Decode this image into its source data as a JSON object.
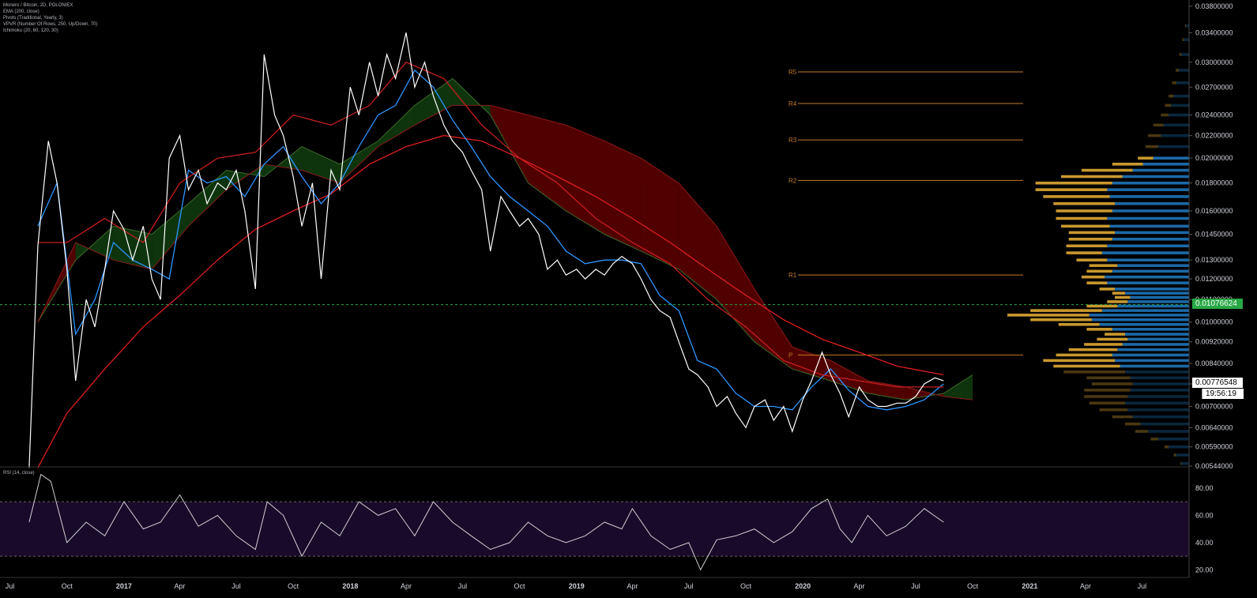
{
  "legend": [
    "Monero / Bitcoin, 2D, POLONIEX",
    "EMA (200, close)",
    "Pivots (Traditional, Yearly, 3)",
    "VPVR (Number Of Rows, 250, Up/Down, 70)",
    "Ichimoku (20, 60, 120, 30)"
  ],
  "rsi_label": "RSI (14, close)",
  "tags": {
    "last_price": "0.00776548",
    "countdown": "19:56:19",
    "horizontal_line_price": "0.01076624"
  },
  "colors": {
    "background": "#000000",
    "price_line": "#ffffff",
    "ema": "#e01e1e",
    "kijun": "#2e95ff",
    "tenkan": "#c81e1e",
    "cloud_bear": "#5a0000",
    "cloud_bull": "#0f3a0f",
    "pivots": "#c47a2a",
    "vp_up": "#1e6fb0",
    "vp_down": "#d4a030",
    "rsi_line": "#cfcfcf",
    "rsi_band": "#1a0a2a",
    "hline": "#27a844"
  },
  "chart_data": [
    {
      "type": "line",
      "log_scale": true,
      "y_ticks": [
        "0.03800000",
        "0.03400000",
        "0.03000000",
        "0.02700000",
        "0.02400000",
        "0.02200000",
        "0.02000000",
        "0.01800000",
        "0.01600000",
        "0.01450000",
        "0.01300000",
        "0.01200000",
        "0.01100000",
        "0.01000000",
        "0.00920000",
        "0.00840000",
        "0.00770000",
        "0.00700000",
        "0.00640000",
        "0.00590000",
        "0.00544000"
      ],
      "x_ticks": [
        "Jul",
        "Oct",
        "2017",
        "Apr",
        "Jul",
        "Oct",
        "2018",
        "Apr",
        "Jul",
        "Oct",
        "2019",
        "Apr",
        "Jul",
        "Oct",
        "2020",
        "Apr",
        "Jul",
        "Oct",
        "2021",
        "Apr",
        "Jul"
      ],
      "x_range": [
        "2016-06-15",
        "2021-09-15"
      ],
      "y_range": [
        0.00544,
        0.038
      ],
      "price": {
        "x": [
          "2016-08-01",
          "2016-08-15",
          "2016-09-01",
          "2016-09-15",
          "2016-10-01",
          "2016-10-15",
          "2016-11-01",
          "2016-11-15",
          "2016-12-01",
          "2016-12-15",
          "2017-01-01",
          "2017-01-15",
          "2017-02-01",
          "2017-02-15",
          "2017-03-01",
          "2017-03-15",
          "2017-04-01",
          "2017-04-15",
          "2017-05-01",
          "2017-05-15",
          "2017-06-01",
          "2017-06-15",
          "2017-07-01",
          "2017-07-15",
          "2017-08-01",
          "2017-08-15",
          "2017-09-01",
          "2017-09-15",
          "2017-10-01",
          "2017-10-15",
          "2017-11-01",
          "2017-11-15",
          "2017-12-01",
          "2017-12-15",
          "2018-01-01",
          "2018-01-15",
          "2018-02-01",
          "2018-02-15",
          "2018-03-01",
          "2018-03-15",
          "2018-04-01",
          "2018-04-15",
          "2018-05-01",
          "2018-05-15",
          "2018-06-01",
          "2018-06-15",
          "2018-07-01",
          "2018-07-15",
          "2018-08-01",
          "2018-08-15",
          "2018-09-01",
          "2018-09-15",
          "2018-10-01",
          "2018-10-15",
          "2018-11-01",
          "2018-11-15",
          "2018-12-01",
          "2018-12-15",
          "2019-01-01",
          "2019-01-15",
          "2019-02-01",
          "2019-02-15",
          "2019-03-01",
          "2019-03-15",
          "2019-04-01",
          "2019-04-15",
          "2019-05-01",
          "2019-05-15",
          "2019-06-01",
          "2019-06-15",
          "2019-07-01",
          "2019-07-15",
          "2019-08-01",
          "2019-08-15",
          "2019-09-01",
          "2019-09-15",
          "2019-10-01",
          "2019-10-15",
          "2019-11-01",
          "2019-11-15",
          "2019-12-01",
          "2019-12-15",
          "2020-01-01",
          "2020-01-15",
          "2020-02-01",
          "2020-02-15",
          "2020-03-01",
          "2020-03-15",
          "2020-04-01",
          "2020-04-15",
          "2020-05-01",
          "2020-05-15",
          "2020-06-01",
          "2020-06-15",
          "2020-07-01",
          "2020-07-15",
          "2020-08-01",
          "2020-08-15"
        ],
        "y": [
          0.0054,
          0.0138,
          0.0215,
          0.018,
          0.0125,
          0.0078,
          0.011,
          0.0098,
          0.0125,
          0.016,
          0.0148,
          0.013,
          0.015,
          0.012,
          0.011,
          0.02,
          0.022,
          0.0175,
          0.019,
          0.0165,
          0.018,
          0.0175,
          0.019,
          0.016,
          0.0115,
          0.031,
          0.024,
          0.022,
          0.0185,
          0.015,
          0.018,
          0.012,
          0.019,
          0.0175,
          0.027,
          0.024,
          0.03,
          0.026,
          0.031,
          0.028,
          0.034,
          0.027,
          0.03,
          0.026,
          0.023,
          0.0215,
          0.0205,
          0.019,
          0.0175,
          0.0135,
          0.017,
          0.016,
          0.015,
          0.0155,
          0.0145,
          0.0125,
          0.013,
          0.0122,
          0.0125,
          0.012,
          0.0125,
          0.0122,
          0.0128,
          0.0132,
          0.0128,
          0.012,
          0.011,
          0.0105,
          0.0102,
          0.0092,
          0.0082,
          0.008,
          0.0076,
          0.007,
          0.0073,
          0.0068,
          0.0064,
          0.007,
          0.0072,
          0.0066,
          0.007,
          0.0063,
          0.0072,
          0.0078,
          0.0088,
          0.008,
          0.0074,
          0.0067,
          0.0076,
          0.0072,
          0.007,
          0.007,
          0.0071,
          0.0071,
          0.0073,
          0.0077,
          0.0079,
          0.0078
        ]
      },
      "series": [
        {
          "indicator": "EMA",
          "x": [
            "2016-08-15",
            "2016-10-01",
            "2016-12-01",
            "2017-02-01",
            "2017-04-01",
            "2017-06-01",
            "2017-08-01",
            "2017-10-01",
            "2017-12-01",
            "2018-02-01",
            "2018-04-01",
            "2018-06-01",
            "2018-08-01",
            "2018-10-01",
            "2018-12-01",
            "2019-02-01",
            "2019-04-01",
            "2019-06-01",
            "2019-08-01",
            "2019-10-01",
            "2019-12-01",
            "2020-02-01",
            "2020-04-01",
            "2020-06-01",
            "2020-08-15"
          ],
          "y": [
            0.0054,
            0.0068,
            0.0082,
            0.0098,
            0.0112,
            0.013,
            0.0148,
            0.016,
            0.0172,
            0.0195,
            0.021,
            0.022,
            0.0215,
            0.02,
            0.0185,
            0.017,
            0.0155,
            0.014,
            0.0125,
            0.0112,
            0.0101,
            0.0093,
            0.0088,
            0.0083,
            0.008
          ]
        },
        {
          "indicator": "Kijun",
          "x": [
            "2016-08-15",
            "2016-09-15",
            "2016-10-15",
            "2016-11-15",
            "2016-12-15",
            "2017-01-15",
            "2017-02-15",
            "2017-03-15",
            "2017-04-15",
            "2017-05-15",
            "2017-06-15",
            "2017-07-15",
            "2017-08-15",
            "2017-09-15",
            "2017-10-15",
            "2017-11-15",
            "2017-12-15",
            "2018-01-15",
            "2018-02-15",
            "2018-03-15",
            "2018-04-15",
            "2018-05-15",
            "2018-06-15",
            "2018-07-15",
            "2018-08-15",
            "2018-09-15",
            "2018-10-15",
            "2018-11-15",
            "2018-12-15",
            "2019-01-15",
            "2019-02-15",
            "2019-03-15",
            "2019-04-15",
            "2019-05-15",
            "2019-06-15",
            "2019-07-15",
            "2019-08-15",
            "2019-09-15",
            "2019-10-15",
            "2019-11-15",
            "2019-12-15",
            "2020-01-15",
            "2020-02-15",
            "2020-03-15",
            "2020-04-15",
            "2020-05-15",
            "2020-06-15",
            "2020-07-15",
            "2020-08-15"
          ],
          "y": [
            0.015,
            0.018,
            0.0095,
            0.011,
            0.014,
            0.013,
            0.0125,
            0.012,
            0.019,
            0.018,
            0.0185,
            0.017,
            0.0195,
            0.021,
            0.0185,
            0.0165,
            0.018,
            0.021,
            0.024,
            0.025,
            0.029,
            0.027,
            0.0235,
            0.021,
            0.0185,
            0.017,
            0.016,
            0.015,
            0.0135,
            0.0128,
            0.013,
            0.013,
            0.0128,
            0.0112,
            0.0105,
            0.0085,
            0.0082,
            0.0074,
            0.007,
            0.007,
            0.0069,
            0.0076,
            0.0082,
            0.0075,
            0.007,
            0.0069,
            0.007,
            0.0072,
            0.0077
          ]
        },
        {
          "indicator": "Tenkan",
          "x": [
            "2016-08-15",
            "2016-10-01",
            "2016-12-01",
            "2017-02-01",
            "2017-04-01",
            "2017-06-01",
            "2017-08-01",
            "2017-10-01",
            "2017-12-01",
            "2018-02-01",
            "2018-04-01",
            "2018-06-01",
            "2018-08-01",
            "2018-10-01",
            "2018-12-01",
            "2019-02-01",
            "2019-04-01",
            "2019-06-01",
            "2019-08-01",
            "2019-10-01",
            "2019-12-01",
            "2020-02-01",
            "2020-04-01",
            "2020-06-01",
            "2020-08-15"
          ],
          "y": [
            0.014,
            0.014,
            0.0155,
            0.014,
            0.018,
            0.02,
            0.0205,
            0.024,
            0.023,
            0.025,
            0.03,
            0.028,
            0.023,
            0.02,
            0.018,
            0.0155,
            0.014,
            0.0128,
            0.011,
            0.0098,
            0.0085,
            0.008,
            0.0078,
            0.0076,
            0.0076
          ]
        },
        {
          "indicator": "RSI",
          "x": [
            "2016-08-01",
            "2016-08-20",
            "2016-09-05",
            "2016-10-01",
            "2016-11-01",
            "2016-12-01",
            "2017-01-01",
            "2017-02-01",
            "2017-03-01",
            "2017-04-01",
            "2017-05-01",
            "2017-06-01",
            "2017-07-01",
            "2017-08-01",
            "2017-08-20",
            "2017-09-15",
            "2017-10-15",
            "2017-11-15",
            "2017-12-15",
            "2018-01-15",
            "2018-02-15",
            "2018-03-15",
            "2018-04-15",
            "2018-05-15",
            "2018-06-15",
            "2018-07-15",
            "2018-08-15",
            "2018-09-15",
            "2018-10-15",
            "2018-11-15",
            "2018-12-15",
            "2019-01-15",
            "2019-02-15",
            "2019-03-15",
            "2019-04-01",
            "2019-05-01",
            "2019-06-01",
            "2019-07-01",
            "2019-07-20",
            "2019-08-15",
            "2019-09-15",
            "2019-10-15",
            "2019-11-15",
            "2019-12-15",
            "2020-01-15",
            "2020-02-10",
            "2020-03-01",
            "2020-03-20",
            "2020-04-15",
            "2020-05-15",
            "2020-06-15",
            "2020-07-15",
            "2020-08-15"
          ],
          "y": [
            55,
            90,
            85,
            40,
            55,
            45,
            70,
            50,
            55,
            75,
            52,
            60,
            45,
            35,
            70,
            60,
            30,
            55,
            45,
            70,
            60,
            65,
            45,
            70,
            55,
            45,
            35,
            40,
            55,
            45,
            40,
            45,
            55,
            50,
            65,
            45,
            35,
            40,
            20,
            42,
            45,
            50,
            40,
            48,
            65,
            72,
            50,
            40,
            60,
            45,
            52,
            65,
            55
          ],
          "ylim": [
            15,
            95
          ],
          "y_ticks": [
            "80.00",
            "60.00",
            "40.00",
            "20.00"
          ],
          "bands": [
            70,
            30
          ]
        }
      ],
      "ichimoku_cloud": {
        "x": [
          "2016-08-15",
          "2016-10-15",
          "2016-12-15",
          "2017-02-15",
          "2017-04-15",
          "2017-06-15",
          "2017-08-15",
          "2017-10-15",
          "2017-12-15",
          "2018-02-15",
          "2018-04-15",
          "2018-06-15",
          "2018-08-15",
          "2018-10-15",
          "2018-12-15",
          "2019-02-15",
          "2019-04-15",
          "2019-06-15",
          "2019-08-15",
          "2019-10-15",
          "2019-12-15",
          "2020-02-15",
          "2020-04-15",
          "2020-06-15",
          "2020-08-15",
          "2020-10-01"
        ],
        "span_a": [
          0.01,
          0.013,
          0.015,
          0.0145,
          0.0165,
          0.019,
          0.0185,
          0.021,
          0.0195,
          0.0215,
          0.025,
          0.028,
          0.024,
          0.018,
          0.016,
          0.0145,
          0.0135,
          0.0125,
          0.011,
          0.0092,
          0.0082,
          0.0078,
          0.0074,
          0.0072,
          0.0074,
          0.008
        ],
        "span_b": [
          0.01,
          0.014,
          0.013,
          0.0125,
          0.015,
          0.0175,
          0.0195,
          0.019,
          0.018,
          0.021,
          0.023,
          0.025,
          0.025,
          0.024,
          0.023,
          0.0215,
          0.02,
          0.018,
          0.015,
          0.0115,
          0.009,
          0.0085,
          0.0078,
          0.0076,
          0.0073,
          0.0072
        ]
      },
      "pivots": [
        {
          "label": "R5",
          "value": 0.0288
        },
        {
          "label": "R4",
          "value": 0.0252
        },
        {
          "label": "R3",
          "value": 0.0216
        },
        {
          "label": "R2",
          "value": 0.0182
        },
        {
          "label": "R1",
          "value": 0.0122
        },
        {
          "label": "P",
          "value": 0.0087
        }
      ],
      "horizontal_line": 0.01076624,
      "volume_profile": {
        "price": [
          0.0055,
          0.0057,
          0.0059,
          0.0061,
          0.0063,
          0.0065,
          0.0067,
          0.0069,
          0.0071,
          0.0073,
          0.0075,
          0.0077,
          0.0079,
          0.0081,
          0.0083,
          0.0085,
          0.0087,
          0.0089,
          0.0091,
          0.0093,
          0.0095,
          0.0097,
          0.0099,
          0.0101,
          0.0103,
          0.0105,
          0.0107,
          0.0109,
          0.0111,
          0.0113,
          0.0115,
          0.0118,
          0.0121,
          0.0124,
          0.0127,
          0.013,
          0.0134,
          0.0138,
          0.0142,
          0.0146,
          0.015,
          0.0155,
          0.016,
          0.0165,
          0.017,
          0.0175,
          0.018,
          0.0185,
          0.019,
          0.0195,
          0.02,
          0.021,
          0.022,
          0.023,
          0.024,
          0.025,
          0.026,
          0.0275,
          0.029,
          0.031,
          0.033,
          0.035
        ],
        "up": [
          15,
          25,
          40,
          60,
          80,
          95,
          110,
          120,
          125,
          120,
          115,
          110,
          115,
          125,
          135,
          145,
          150,
          140,
          130,
          120,
          125,
          150,
          175,
          190,
          195,
          170,
          140,
          120,
          115,
          125,
          145,
          160,
          165,
          150,
          140,
          160,
          170,
          160,
          150,
          145,
          155,
          160,
          150,
          145,
          155,
          160,
          150,
          130,
          110,
          90,
          70,
          60,
          55,
          50,
          40,
          35,
          30,
          25,
          20,
          15,
          10,
          6
        ],
        "down": [
          2,
          5,
          8,
          15,
          25,
          30,
          40,
          55,
          70,
          85,
          90,
          80,
          85,
          120,
          130,
          140,
          110,
          95,
          75,
          60,
          40,
          50,
          80,
          120,
          160,
          140,
          60,
          40,
          30,
          25,
          30,
          40,
          45,
          50,
          55,
          60,
          70,
          80,
          85,
          90,
          95,
          100,
          110,
          120,
          130,
          140,
          150,
          120,
          100,
          60,
          30,
          25,
          25,
          20,
          15,
          12,
          10,
          8,
          6,
          4,
          3,
          2
        ]
      }
    }
  ]
}
